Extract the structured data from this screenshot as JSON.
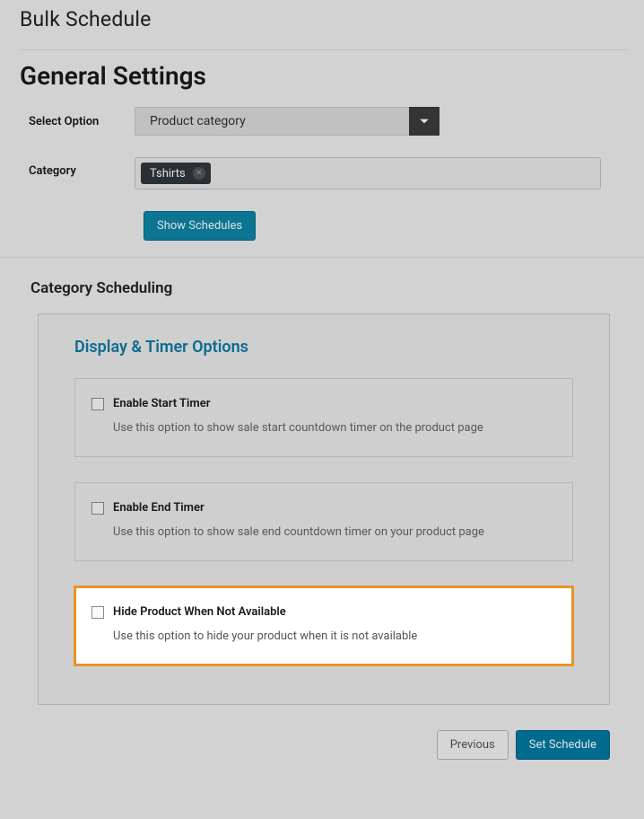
{
  "page": {
    "title": "Bulk Schedule",
    "heading": "General Settings"
  },
  "form": {
    "select_option_label": "Select Option",
    "select_option_value": "Product category",
    "category_label": "Category",
    "category_chip": "Tshirts",
    "show_schedules_btn": "Show Schedules"
  },
  "scheduling": {
    "title": "Category Scheduling"
  },
  "panel": {
    "title": "Display & Timer Options",
    "options": [
      {
        "label": "Enable Start Timer",
        "desc": "Use this option to show sale start countdown timer on the product page"
      },
      {
        "label": "Enable End Timer",
        "desc": "Use this option to show sale end countdown timer on your product page"
      },
      {
        "label": "Hide Product When Not Available",
        "desc": "Use this option to hide your product when it is not available"
      }
    ]
  },
  "footer": {
    "previous": "Previous",
    "set_schedule": "Set Schedule"
  }
}
